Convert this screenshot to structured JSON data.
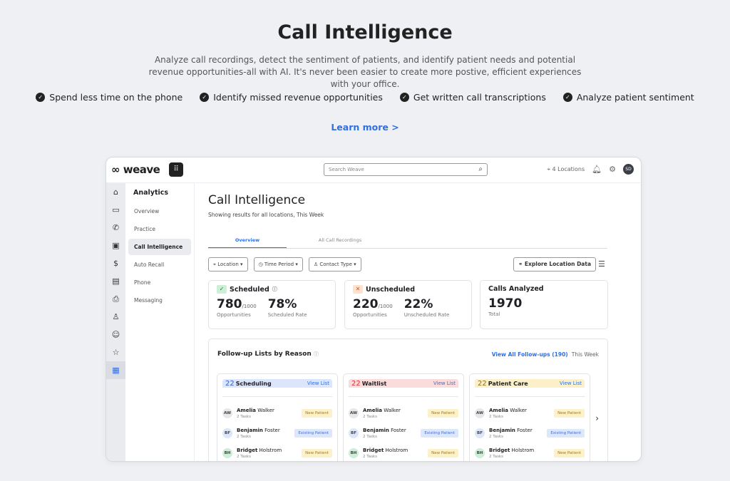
{
  "hero": {
    "title": "Call Intelligence",
    "subtitle": "Analyze call recordings, detect the sentiment of patients, and identify patient needs and potential revenue opportunities-all with AI. It's never been easier to create more postive, efficient experiences with your office.",
    "features": [
      "Spend less time on the phone",
      "Identify missed revenue opportunities",
      "Get written call transcriptions",
      "Analyze patient sentiment"
    ],
    "learn_more": "Learn more >"
  },
  "app": {
    "logo": "weave",
    "search_placeholder": "Search Weave",
    "locations": "4 Locations",
    "avatar": "SD",
    "rail_icons": [
      "home-icon",
      "inbox-icon",
      "phone-icon",
      "calendar-icon",
      "payments-icon",
      "forms-icon",
      "fax-icon",
      "contacts-icon",
      "reviews-icon",
      "star-icon",
      "analytics-icon"
    ],
    "nav": {
      "title": "Analytics",
      "items": [
        "Overview",
        "Practice",
        "Call Intelligence",
        "Auto Recall",
        "Phone",
        "Messaging"
      ],
      "active": "Call Intelligence"
    },
    "page": {
      "title": "Call Intelligence",
      "subtitle": "Showing results for all locations, This Week",
      "tabs": [
        "Overview",
        "All Call Recordings"
      ],
      "filters": [
        "Location",
        "Time Period",
        "Contact Type"
      ],
      "explore": "Explore Location Data",
      "cards": {
        "scheduled": {
          "title": "Scheduled",
          "value": "780",
          "of": "/1000",
          "value_label": "Opportunities",
          "rate": "78%",
          "rate_label": "Scheduled Rate"
        },
        "unscheduled": {
          "title": "Unscheduled",
          "value": "220",
          "of": "/1000",
          "value_label": "Opportunities",
          "rate": "22%",
          "rate_label": "Unscheduled Rate"
        },
        "calls": {
          "title": "Calls Analyzed",
          "value": "1970",
          "value_label": "Total"
        }
      },
      "followups": {
        "title": "Follow-up Lists by Reason",
        "view_all": "View All Follow-ups (190)",
        "period": "This Week",
        "lists": [
          {
            "count": "22",
            "name": "Scheduling",
            "view": "View List",
            "color": "#dbe6fd",
            "count_color": "#2f5fd0"
          },
          {
            "count": "22",
            "name": "Waitlist",
            "view": "View List",
            "color": "#fbdcdc",
            "count_color": "#d33"
          },
          {
            "count": "22",
            "name": "Patient Care",
            "view": "View List",
            "color": "#fcf0c8",
            "count_color": "#8a6d1a"
          }
        ],
        "people": [
          {
            "initials": "AW",
            "first": "Amelia",
            "last": "Walker",
            "tasks": "2 Tasks",
            "tag": "New Patient",
            "avatar_color": "#e6e7ea",
            "tag_bg": "#fdf1c9",
            "tag_color": "#9a7a20"
          },
          {
            "initials": "BF",
            "first": "Benjamin",
            "last": "Foster",
            "tasks": "2 Tasks",
            "tag": "Existing Patient",
            "avatar_color": "#dce6fb",
            "tag_bg": "#dde7fc",
            "tag_color": "#3b6fd8"
          },
          {
            "initials": "BH",
            "first": "Bridget",
            "last": "Holstrom",
            "tasks": "2 Tasks",
            "tag": "New Patient",
            "avatar_color": "#cdeed7",
            "tag_bg": "#fdf1c9",
            "tag_color": "#9a7a20"
          }
        ]
      }
    }
  }
}
